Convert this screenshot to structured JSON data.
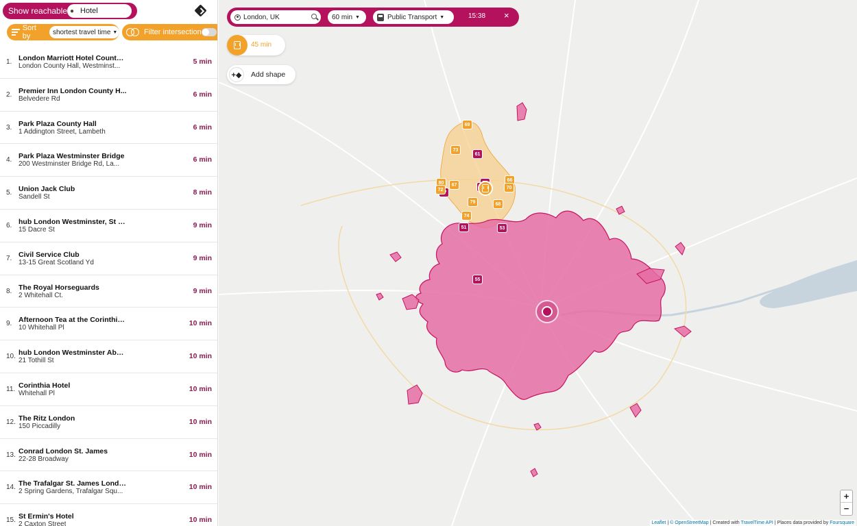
{
  "sidebar": {
    "reach_button": "Show reachable",
    "place_query": "Hotel",
    "sort_label": "Sort by",
    "sort_value": "shortest travel time",
    "filter_label": "Filter intersection",
    "filter_on": false
  },
  "results": [
    {
      "rank": "1.",
      "name": "London Marriott Hotel County ...",
      "address": "London County Hall, Westminst...",
      "time": "5 min"
    },
    {
      "rank": "2.",
      "name": "Premier Inn London County H...",
      "address": "Belvedere Rd",
      "time": "6 min"
    },
    {
      "rank": "3.",
      "name": "Park Plaza County Hall",
      "address": "1 Addington Street, Lambeth",
      "time": "6 min"
    },
    {
      "rank": "4.",
      "name": "Park Plaza Westminster Bridge",
      "address": "200 Westminster Bridge Rd, La...",
      "time": "6 min"
    },
    {
      "rank": "5.",
      "name": "Union Jack Club",
      "address": "Sandell St",
      "time": "8 min"
    },
    {
      "rank": "6.",
      "name": "hub London Westminster, St J...",
      "address": "15 Dacre St",
      "time": "9 min"
    },
    {
      "rank": "7.",
      "name": "Civil Service Club",
      "address": "13-15 Great Scotland Yd",
      "time": "9 min"
    },
    {
      "rank": "8.",
      "name": "The Royal Horseguards",
      "address": "2 Whitehall Ct.",
      "time": "9 min"
    },
    {
      "rank": "9.",
      "name": "Afternoon Tea at the Corinthia...",
      "address": "10 Whitehall Pl",
      "time": "10 min"
    },
    {
      "rank": "10.",
      "name": "hub London Westminster Abb...",
      "address": "21 Tothill St",
      "time": "10 min"
    },
    {
      "rank": "11.",
      "name": "Corinthia Hotel",
      "address": "Whitehall Pl",
      "time": "10 min"
    },
    {
      "rank": "12.",
      "name": "The Ritz London",
      "address": "150 Piccadilly",
      "time": "10 min"
    },
    {
      "rank": "13.",
      "name": "Conrad London St. James",
      "address": "22-28 Broadway",
      "time": "10 min"
    },
    {
      "rank": "14.",
      "name": "The Trafalgar St. James Londo...",
      "address": "2 Spring Gardens, Trafalgar Squ...",
      "time": "10 min"
    },
    {
      "rank": "15.",
      "name": "St Ermin's Hotel",
      "address": "2 Caxton Street",
      "time": "10 min"
    }
  ],
  "search": {
    "location": "London, UK",
    "travel_time": "60 min",
    "transport_mode": "Public Transport",
    "departure_time": "15:38",
    "close_symbol": "×"
  },
  "shape_chip": {
    "label": "45 min"
  },
  "add_shape": {
    "label": "Add shape"
  },
  "zoom": {
    "in": "+",
    "out": "−"
  },
  "markers_pink": [
    "61",
    "58",
    "5",
    "57",
    "51",
    "53",
    "55"
  ],
  "markers_orange": [
    "69",
    "73",
    "80",
    "72",
    "67",
    "79",
    "74",
    "68",
    "66",
    "70"
  ],
  "attribution": {
    "leaflet": "Leaflet",
    "osm": "© OpenStreetMap",
    "created_prefix": "Created with",
    "traveltime": "TravelTime API",
    "places_prefix": "Places data provided by",
    "foursquare": "Foursquare"
  },
  "colors": {
    "brand": "#b4125d",
    "accent_orange": "#f2a12b",
    "isochrone_fill": "#e56da5",
    "isochrone_stroke": "#c8135f",
    "isochrone_45_fill": "#f7cf8d",
    "map_bg": "#efefed"
  }
}
